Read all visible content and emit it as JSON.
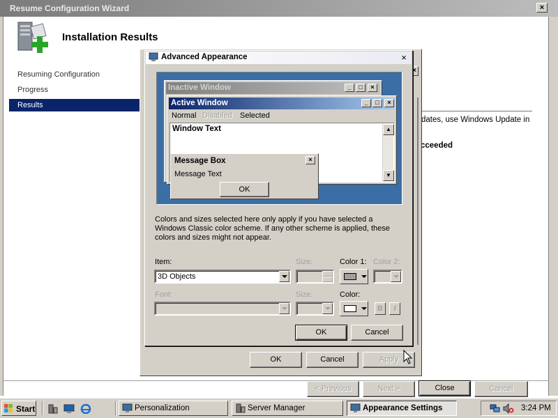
{
  "wizard": {
    "title": "Resume Configuration Wizard",
    "close_label": "×",
    "heading": "Installation Results",
    "nav": [
      "Resuming Configuration",
      "Progress",
      "Results"
    ],
    "text_update": "dates, use Windows Update in",
    "text_succeeded": "cceeded",
    "buttons": {
      "previous": "< Previous",
      "next": "Next >",
      "close": "Close",
      "cancel": "Cancel"
    }
  },
  "middle_dialog": {
    "close_label": "×",
    "buttons": {
      "ok": "OK",
      "cancel": "Cancel",
      "apply": "Apply"
    }
  },
  "advanced": {
    "title": "Advanced Appearance",
    "close_label": "×",
    "preview": {
      "inactive_title": "Inactive Window",
      "active_title": "Active Window",
      "menu": {
        "normal": "Normal",
        "disabled": "Disabled",
        "selected": "Selected"
      },
      "window_text": "Window Text",
      "msgbox_title": "Message Box",
      "msgbox_text": "Message Text",
      "msgbox_ok": "OK"
    },
    "description": "Colors and sizes selected here only apply if you have selected a Windows Classic color scheme. If any other scheme is applied, these colors and sizes might not appear.",
    "item_label": "Item:",
    "item_value": "3D Objects",
    "size_label": "Size:",
    "color1_label": "Color 1:",
    "color2_label": "Color 2:",
    "font_label": "Font:",
    "font_size_label": "Size:",
    "color_label": "Color:",
    "bold_label": "B",
    "italic_label": "I",
    "buttons": {
      "ok": "OK",
      "cancel": "Cancel"
    },
    "colors": {
      "color1_swatch": "#a0a0a0",
      "font_color_swatch": "#ffffff"
    }
  },
  "taskbar": {
    "start_label": "Start",
    "tasks": [
      "Personalization",
      "Server Manager",
      "Appearance Settings"
    ],
    "clock": "3:24 PM"
  },
  "icons": [
    "server-wizard-icon",
    "display-icon",
    "windows-logo-icon",
    "server-manager-icon",
    "desktop-icon",
    "ie-icon",
    "network-icon",
    "volume-muted-icon",
    "mouse-cursor-icon"
  ]
}
